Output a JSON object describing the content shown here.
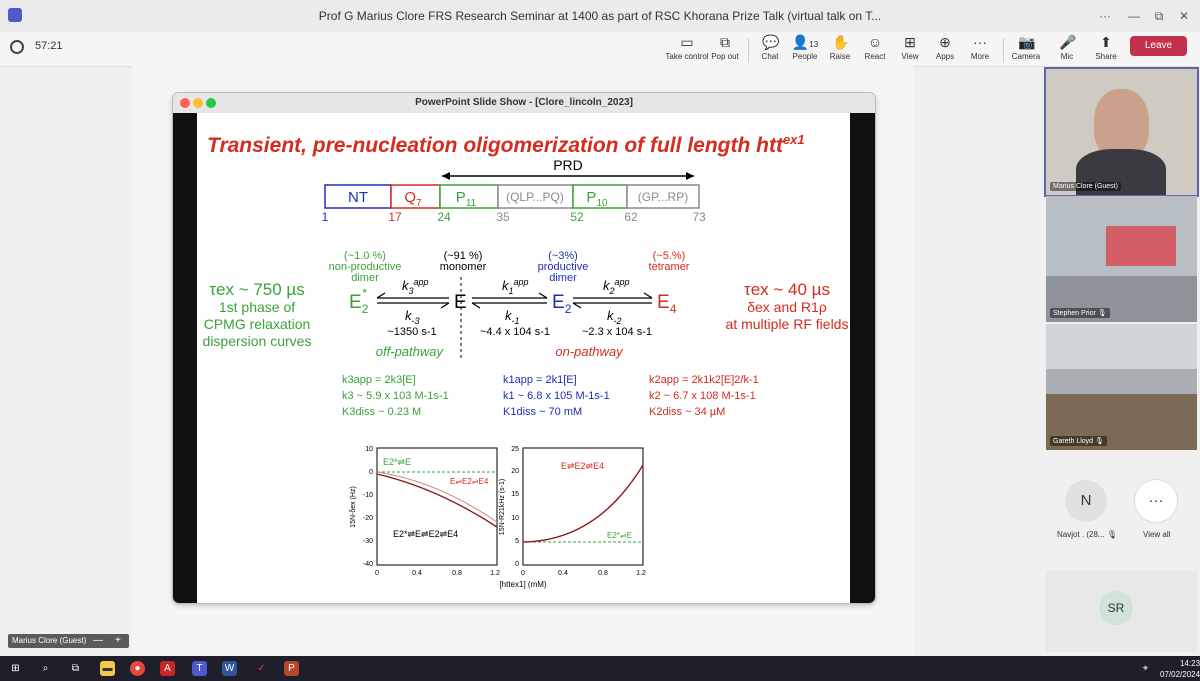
{
  "window": {
    "title": "Prof G Marius Clore FRS Research Seminar at 1400 as part of RSC Khorana Prize Talk (virtual talk on T...",
    "controls": [
      "···",
      "—",
      "⧉",
      "✕"
    ]
  },
  "meeting": {
    "timer": "57:21",
    "tools": [
      {
        "label": "Take control",
        "icon": "take-control-icon"
      },
      {
        "label": "Pop out",
        "icon": "pop-out-icon"
      },
      {
        "label": "Chat",
        "icon": "chat-icon"
      },
      {
        "label": "People",
        "icon": "people-icon",
        "badge": "13"
      },
      {
        "label": "Raise",
        "icon": "raise-hand-icon"
      },
      {
        "label": "React",
        "icon": "react-icon"
      },
      {
        "label": "View",
        "icon": "view-icon"
      },
      {
        "label": "Apps",
        "icon": "apps-icon"
      },
      {
        "label": "More",
        "icon": "more-icon"
      },
      {
        "label": "Camera",
        "icon": "camera-off-icon"
      },
      {
        "label": "Mic",
        "icon": "mic-off-icon"
      },
      {
        "label": "Share",
        "icon": "share-icon"
      }
    ],
    "leave_label": "Leave",
    "leave_color": "#c4314b"
  },
  "presentation": {
    "window_title": "PowerPoint Slide Show - [Clore_lincoln_2023]",
    "presenter_label": "Marius Clore (Guest)",
    "zoom_minus": "—",
    "zoom_plus": "+"
  },
  "slide": {
    "title": "Transient, pre-nucleation oligomerization of full length htt",
    "title_sup": "ex1",
    "prd_label": "PRD",
    "domains": [
      "NT",
      "Q",
      "P",
      "(QLP...PQ)",
      "P",
      "(GP...RP)"
    ],
    "domain_subs": [
      "",
      "7",
      "11",
      "",
      "10",
      ""
    ],
    "positions": [
      "1",
      "17",
      "24",
      "35",
      "52",
      "62",
      "73"
    ],
    "left_text": [
      "τex ~ 750 µs",
      "1st phase of",
      "CPMG relaxation",
      "dispersion curves"
    ],
    "right_text": [
      "τex ~ 40 µs",
      "δex and R1ρ",
      "at multiple RF fields"
    ],
    "species": {
      "e2star": {
        "pct": "(~1.0 %)",
        "line1": "non-productive",
        "line2": "dimer",
        "symbol": "E2*"
      },
      "e": {
        "pct": "(~91 %)",
        "line1": "monomer",
        "symbol": "E"
      },
      "e2": {
        "pct": "(~3%)",
        "line1": "productive",
        "line2": "dimer",
        "symbol": "E2"
      },
      "e4": {
        "pct": "(~5.%)",
        "line1": "tetramer",
        "symbol": "E4"
      }
    },
    "rates": {
      "k3": "~1350 s-1",
      "k1": "~4.4 x 104 s-1",
      "k2": "~2.3 x 104 s-1"
    },
    "pathways": [
      "off-pathway",
      "on-pathway"
    ],
    "equations": {
      "left": [
        "k3app = 2k3[E]",
        "k3 ~ 5.9 x 103 M-1s-1",
        "K3diss ~ 0.23  M"
      ],
      "mid": [
        "k1app = 2k1[E]",
        "k1 ~ 6.8 x 105 M-1s-1",
        "K1diss ~ 70 mM"
      ],
      "right": [
        "k2app = 2k1k2[E]2/k-1",
        "k2 ~ 6.7 x 108 M-1s-1",
        "K2diss ~ 34  µM"
      ]
    },
    "colors": {
      "red": "#d62b1f",
      "green": "#3aa23a",
      "blue": "#1f2fb5",
      "black": "#000000",
      "gray": "#8a8a8a"
    }
  },
  "plot_left": {
    "ylabel": "15N-δex (Hz)",
    "yticks": [
      "10",
      "0",
      "-10",
      "-20",
      "-30",
      "-40"
    ],
    "xticks": [
      "0",
      "0.4",
      "0.8",
      "1.2"
    ],
    "labels": [
      "E2*⇌E",
      "E⇌E2⇌E4",
      "E2*⇌E⇌E2⇌E4"
    ]
  },
  "plot_right": {
    "ylabel": "15N-R21kHz (s-1)",
    "yticks": [
      "25",
      "20",
      "15",
      "10",
      "5",
      "0"
    ],
    "xticks": [
      "0",
      "0.4",
      "0.8",
      "1.2"
    ],
    "xlabel": "[httex1] (mM)",
    "labels": [
      "E⇌E2⇌E4",
      "E2*⇌E"
    ]
  },
  "participants": [
    {
      "name": "Marius Clore (Guest)"
    },
    {
      "name": "Stephen Prior"
    },
    {
      "name": "Gareth Lloyd"
    }
  ],
  "extra": {
    "navjot_initial": "N",
    "navjot_label": "Navjot . (28...",
    "view_all_label": "View all",
    "sr_initials": "SR"
  },
  "taskbar": {
    "time": "14:23",
    "date": "07/02/2024"
  }
}
